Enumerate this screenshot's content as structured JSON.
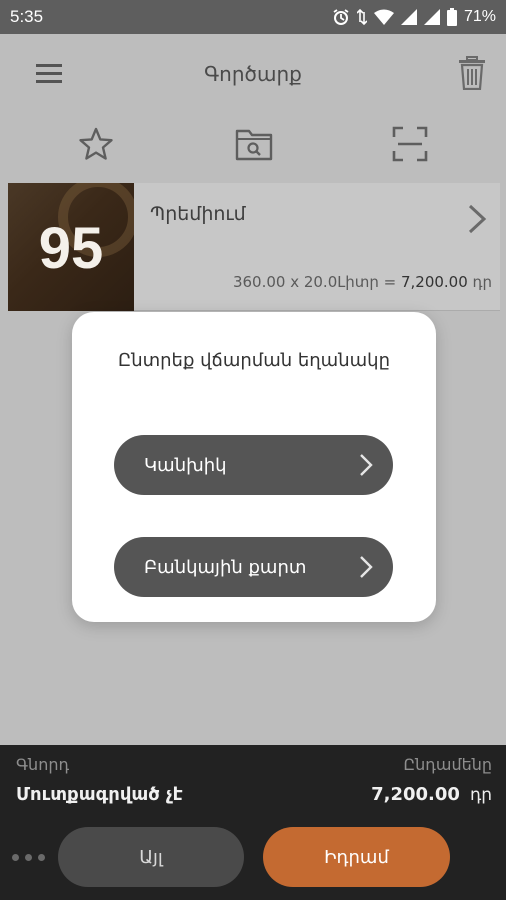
{
  "status_bar": {
    "time": "5:35",
    "battery": "71%",
    "icons": [
      "alarm-icon",
      "data-arrows-icon",
      "wifi-icon",
      "signal-icon",
      "signal-icon",
      "battery-icon"
    ]
  },
  "toolbar": {
    "title": "Գործարք"
  },
  "tools": [
    "star-icon",
    "folder-search-icon",
    "scan-icon"
  ],
  "product": {
    "octane": "95",
    "name": "Պրեմիում",
    "calc_prefix": "360.00 x 20.0Լիտր = ",
    "calc_total": "7,200.00",
    "calc_currency": " դր"
  },
  "dialog": {
    "title": "Ընտրեք վճարման  եղանակը",
    "options": [
      {
        "label": "Կանխիկ"
      },
      {
        "label": "Բանկային քարտ"
      }
    ]
  },
  "bottom": {
    "client_label": "Գնորդ",
    "client_value": "Մուտքագրված չէ",
    "total_label": "Ընդամենը",
    "total_amount": "7,200.00",
    "total_currency": "դր",
    "other_label": "Այլ",
    "pay_label": "Իդրամ"
  },
  "colors": {
    "accent": "#c46a31",
    "bottom_bg": "#222222",
    "button_dark": "#555555"
  }
}
